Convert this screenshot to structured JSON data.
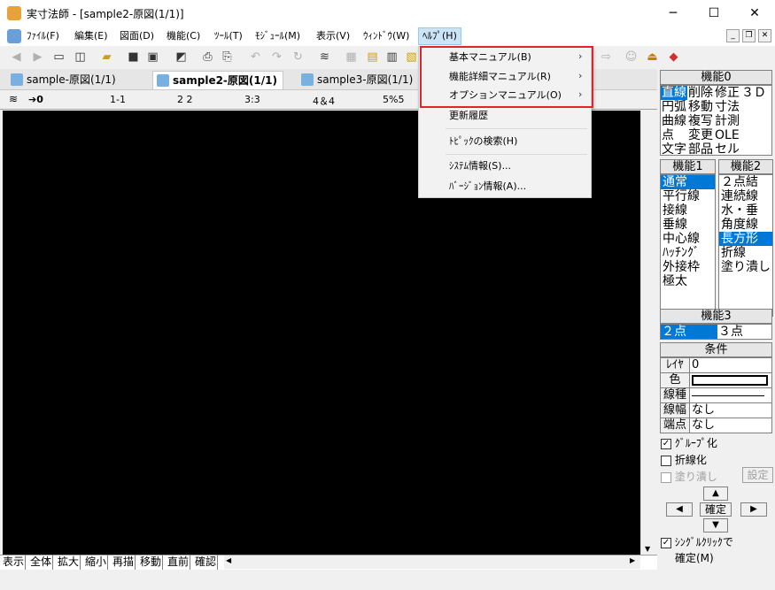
{
  "window": {
    "title": "実寸法師 - [sample2-原図(1/1)]",
    "minimize": "─",
    "maximize": "☐",
    "close": "✕"
  },
  "menu": {
    "file": "ﾌｧｲﾙ(F)",
    "edit": "編集(E)",
    "drawing": "図面(D)",
    "function": "機能(C)",
    "tool": "ﾂｰﾙ(T)",
    "module": "ﾓｼﾞｭｰﾙ(M)",
    "view": "表示(V)",
    "window": "ｳｨﾝﾄﾞｳ(W)",
    "help": "ﾍﾙﾌﾟ(H)"
  },
  "mdi": {
    "minimize": "_",
    "restore": "❐",
    "close": "✕"
  },
  "tabs": [
    "sample-原図(1/1)",
    "sample2-原図(1/1)",
    "sample3-原図(1/1)"
  ],
  "layers": {
    "current": "0",
    "l1": "1-1",
    "l2": "2 2",
    "l3": "3:3",
    "l4": "4＆4",
    "l5": "5%5"
  },
  "help_menu": {
    "basic_manual": "基本マニュアル(B)",
    "detail_manual": "機能詳細マニュアル(R)",
    "option_manual": "オプションマニュアル(O)",
    "history": "更新履歴",
    "topic_search": "ﾄﾋﾟｯｸの検索(H)",
    "system_info": "ｼｽﾃﾑ情報(S)...",
    "version_info": "ﾊﾞｰｼﾞｮﾝ情報(A)..."
  },
  "bottom_buttons": [
    "表示",
    "全体",
    "拡大",
    "縮小",
    "再描",
    "移動",
    "直前",
    "確認"
  ],
  "func0": {
    "header": "機能0",
    "cells": [
      "直線",
      "削除",
      "修正",
      "３Ｄ",
      "円弧",
      "移動",
      "寸法",
      "",
      "曲線",
      "複写",
      "計測",
      "",
      "点",
      "変更",
      "OLE",
      "",
      "文字",
      "部品",
      "セル",
      ""
    ]
  },
  "func1": {
    "header": "機能1",
    "items": [
      "通常",
      "平行線",
      "接線",
      "垂線",
      "中心線",
      "ﾊｯﾁﾝｸﾞ",
      "外接枠",
      "極太"
    ]
  },
  "func2": {
    "header": "機能2",
    "items": [
      "２点結",
      "連続線",
      "水・垂",
      "角度線",
      "長方形",
      "折線",
      "塗り潰し"
    ]
  },
  "func3": {
    "header": "機能3",
    "items": [
      "２点",
      "３点"
    ]
  },
  "conditions": {
    "header": "条件",
    "layer_label": "ﾚｲﾔ",
    "layer_value": "0",
    "color_label": "色",
    "linetype_label": "線種",
    "linewidth_label": "線幅",
    "linewidth_value": "なし",
    "endpoint_label": "端点",
    "endpoint_value": "なし"
  },
  "options": {
    "group": "ｸﾞﾙｰﾌﾟ化",
    "polyline": "折線化",
    "fill": "塗り潰し",
    "settings": "設定",
    "confirm": "確定",
    "single_click": "ｼﾝｸﾞﾙｸﾘｯｸで",
    "single_click2": "確定(M)"
  },
  "colors": {
    "accent": "#0078d7",
    "highlight": "#e0242c",
    "canvas": "#000000"
  }
}
